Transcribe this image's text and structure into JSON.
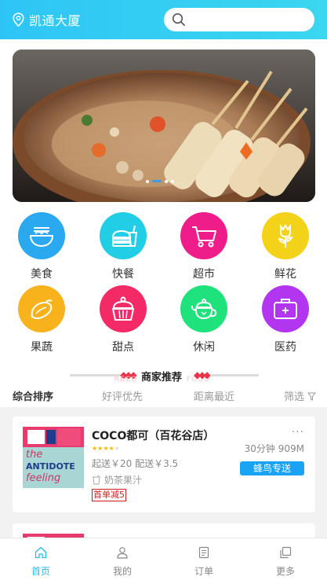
{
  "header": {
    "location": "凯通大厦",
    "search_placeholder": ""
  },
  "categories": [
    {
      "label": "美食",
      "icon": "noodle-bowl-icon",
      "color": "#2aa8f0"
    },
    {
      "label": "快餐",
      "icon": "burger-drink-icon",
      "color": "#22cde6"
    },
    {
      "label": "超市",
      "icon": "shopping-cart-icon",
      "color": "#ee1d8a"
    },
    {
      "label": "鲜花",
      "icon": "flower-icon",
      "color": "#f3d31a"
    },
    {
      "label": "果蔬",
      "icon": "eggplant-icon",
      "color": "#f8b21b"
    },
    {
      "label": "甜点",
      "icon": "cupcake-icon",
      "color": "#f32a66"
    },
    {
      "label": "休闲",
      "icon": "teapot-icon",
      "color": "#1fe27d"
    },
    {
      "label": "医药",
      "icon": "medical-kit-icon",
      "color": "#b236ef"
    }
  ],
  "section": {
    "title": "商家推荐",
    "watermark_left": "RECO",
    "watermark_right": "FOOD"
  },
  "sort": {
    "default": "综合排序",
    "rating": "好评优先",
    "distance": "距离最近",
    "filter": "筛选"
  },
  "shops": [
    {
      "name": "COCO都可（百花谷店）",
      "rating": 4,
      "time_distance": "30分钟 909M",
      "fees": "起送￥20   配送￥3.5",
      "badge": "蜂鸟专送",
      "category": "奶茶果汁",
      "promo": "首单减5",
      "more": "···",
      "thumb_lines": [
        "the",
        "ANTIDOTE",
        "feeling"
      ]
    }
  ],
  "tabs": [
    {
      "label": "首页",
      "icon": "home-icon",
      "active": true
    },
    {
      "label": "我的",
      "icon": "user-icon",
      "active": false
    },
    {
      "label": "订单",
      "icon": "order-icon",
      "active": false
    },
    {
      "label": "更多",
      "icon": "more-icon",
      "active": false
    }
  ],
  "colors": {
    "header": "#2ec5f5",
    "accent": "#26bce8",
    "badge": "#1aa3f5",
    "promo": "#d21d1d"
  }
}
